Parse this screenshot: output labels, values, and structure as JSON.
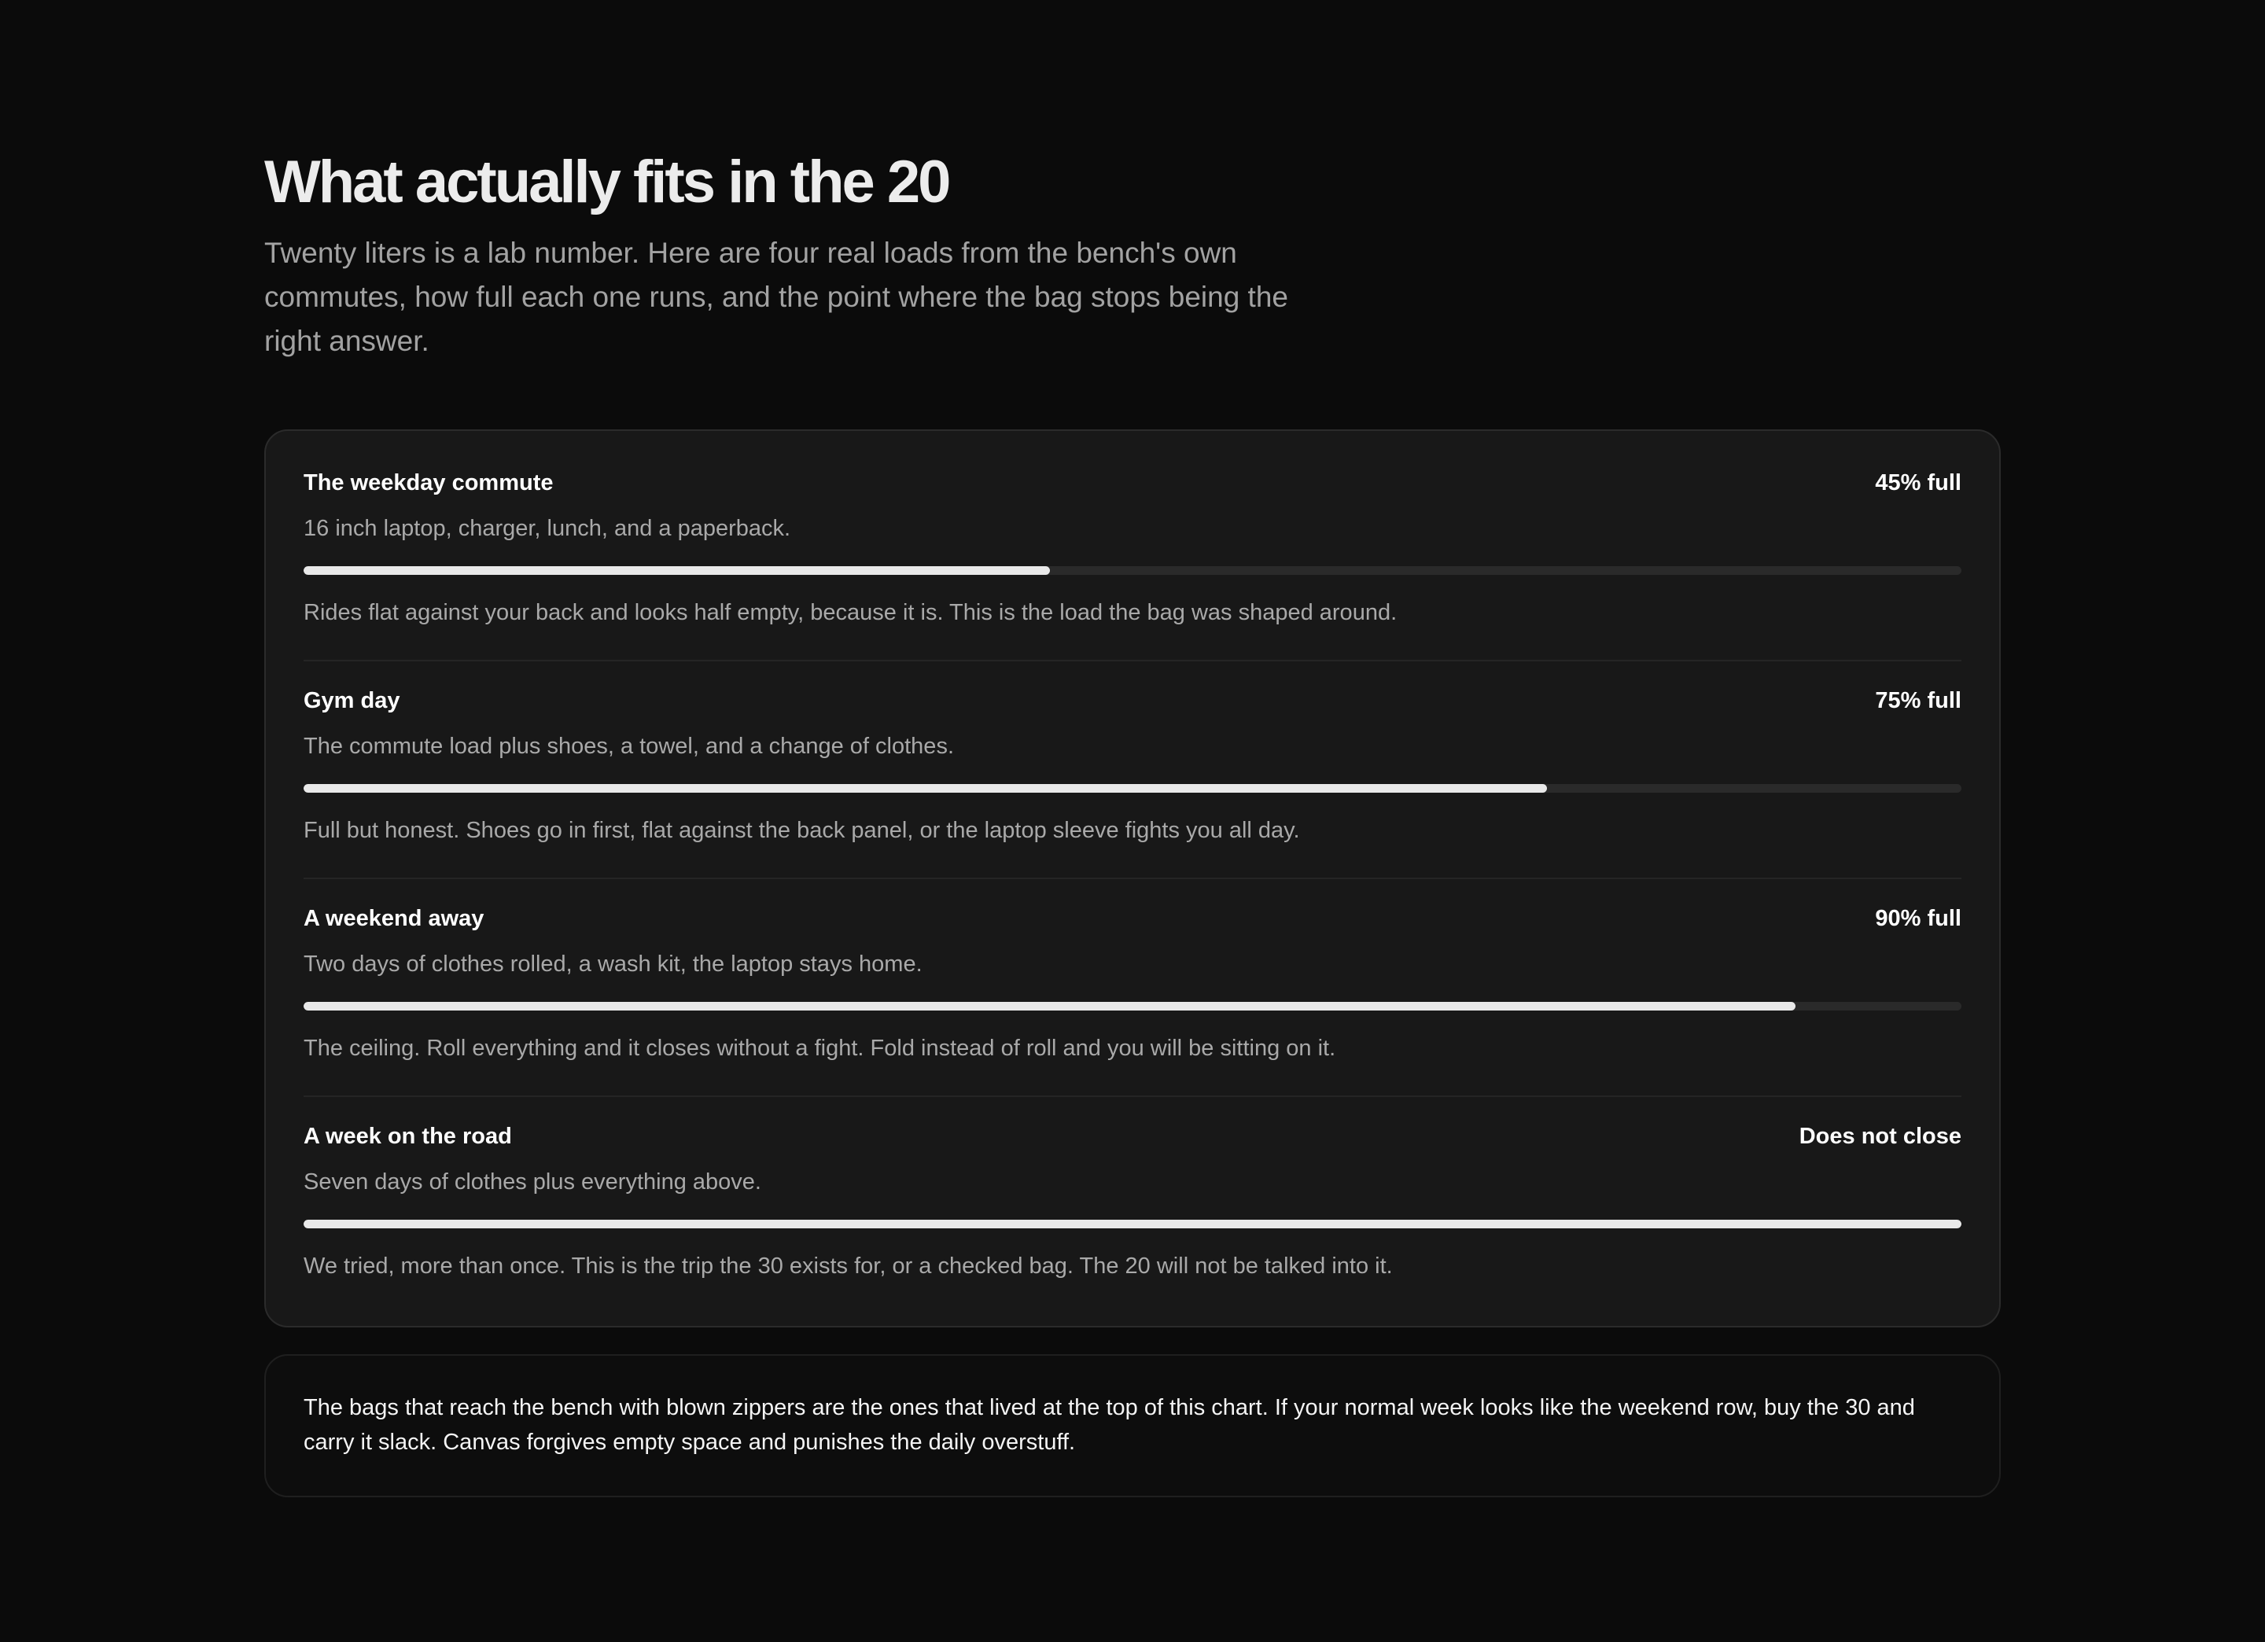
{
  "header": {
    "title": "What actually fits in the 20",
    "intro": "Twenty liters is a lab number. Here are four real loads from the bench's own commutes, how full each one runs, and the point where the bag stops being the right answer."
  },
  "loads": [
    {
      "title": "The weekday commute",
      "status": "45% full",
      "contents": "16 inch laptop, charger, lunch, and a paperback.",
      "fill_percent": 45,
      "verdict": "Rides flat against your back and looks half empty, because it is. This is the load the bag was shaped around."
    },
    {
      "title": "Gym day",
      "status": "75% full",
      "contents": "The commute load plus shoes, a towel, and a change of clothes.",
      "fill_percent": 75,
      "verdict": "Full but honest. Shoes go in first, flat against the back panel, or the laptop sleeve fights you all day."
    },
    {
      "title": "A weekend away",
      "status": "90% full",
      "contents": "Two days of clothes rolled, a wash kit, the laptop stays home.",
      "fill_percent": 90,
      "verdict": "The ceiling. Roll everything and it closes without a fight. Fold instead of roll and you will be sitting on it."
    },
    {
      "title": "A week on the road",
      "status": "Does not close",
      "contents": "Seven days of clothes plus everything above.",
      "fill_percent": 100,
      "verdict": "We tried, more than once. This is the trip the 30 exists for, or a checked bag. The 20 will not be talked into it."
    }
  ],
  "takeaway": "The bags that reach the bench with blown zippers are the ones that lived at the top of this chart. If your normal week looks like the weekend row, buy the 30 and carry it slack. Canvas forgives empty space and punishes the daily overstuff.",
  "colors": {
    "background": "#0b0b0b",
    "card": "#181818",
    "meter_track": "#2a2a2a",
    "meter_fill": "#e9e9e9"
  }
}
